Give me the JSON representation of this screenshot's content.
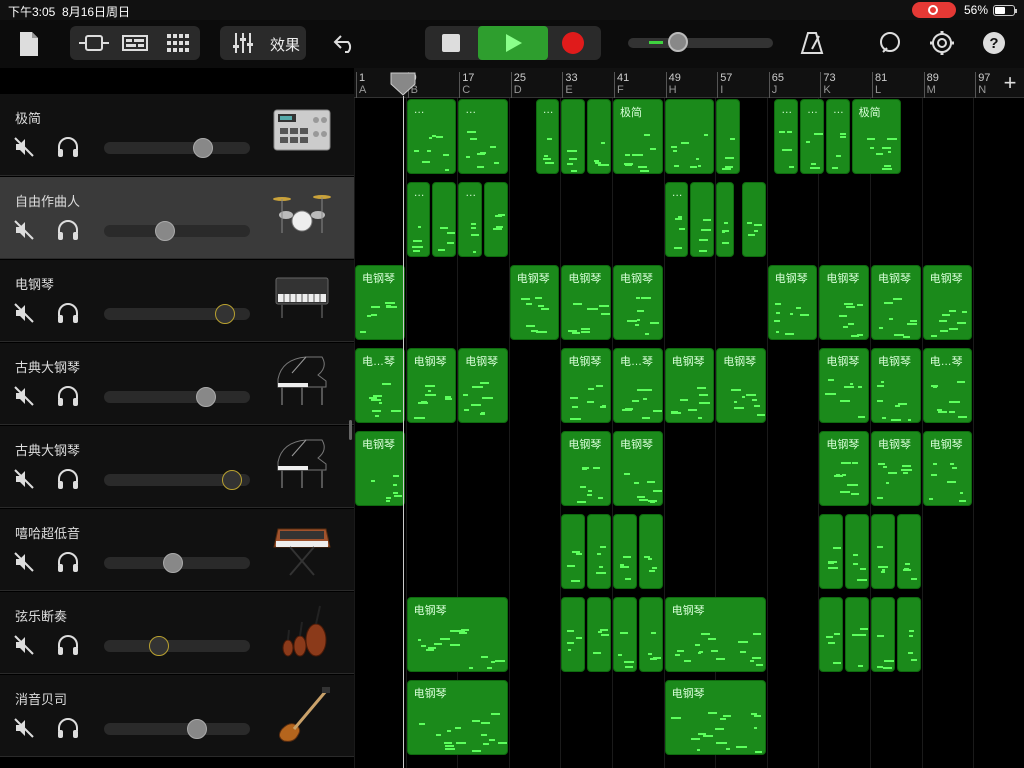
{
  "status_bar": {
    "time": "下午3:05",
    "date": "8月16日周日",
    "battery_pct": "56%"
  },
  "toolbar": {
    "fx_label": "效果",
    "accent": "#2e9e2e",
    "record_color": "#e01b1b"
  },
  "ruler": {
    "bars": [
      {
        "num": "1",
        "letter": "A"
      },
      {
        "num": "9",
        "letter": "B"
      },
      {
        "num": "17",
        "letter": "C"
      },
      {
        "num": "25",
        "letter": "D"
      },
      {
        "num": "33",
        "letter": "E"
      },
      {
        "num": "41",
        "letter": "F"
      },
      {
        "num": "49",
        "letter": "H"
      },
      {
        "num": "57",
        "letter": "I"
      },
      {
        "num": "65",
        "letter": "J"
      },
      {
        "num": "73",
        "letter": "K"
      },
      {
        "num": "81",
        "letter": "L"
      },
      {
        "num": "89",
        "letter": "M"
      },
      {
        "num": "97",
        "letter": "N"
      }
    ],
    "add_label": "+"
  },
  "tracks": [
    {
      "name": "极简",
      "instrument": "drum-machine-icon",
      "volume": 0.68,
      "gold": false,
      "selected": false
    },
    {
      "name": "自由作曲人",
      "instrument": "drum-kit-icon",
      "volume": 0.42,
      "gold": false,
      "selected": true
    },
    {
      "name": "电钢琴",
      "instrument": "electric-piano-icon",
      "volume": 0.83,
      "gold": true,
      "selected": false
    },
    {
      "name": "古典大钢琴",
      "instrument": "grand-piano-icon",
      "volume": 0.7,
      "gold": false,
      "selected": false
    },
    {
      "name": "古典大钢琴",
      "instrument": "grand-piano-icon",
      "volume": 0.88,
      "gold": true,
      "selected": false
    },
    {
      "name": "嘻哈超低音",
      "instrument": "synth-keyboard-icon",
      "volume": 0.47,
      "gold": false,
      "selected": false
    },
    {
      "name": "弦乐断奏",
      "instrument": "strings-icon",
      "volume": 0.38,
      "gold": true,
      "selected": false
    },
    {
      "name": "消音贝司",
      "instrument": "bass-guitar-icon",
      "volume": 0.64,
      "gold": false,
      "selected": false
    }
  ],
  "regions": [
    {
      "track": 0,
      "bars": [
        [
          9,
          17,
          "…"
        ],
        [
          17,
          25,
          "…"
        ],
        [
          29,
          33,
          "…"
        ],
        [
          33,
          37,
          ""
        ],
        [
          37,
          41,
          ""
        ],
        [
          41,
          49,
          "极简"
        ],
        [
          49,
          57,
          ""
        ],
        [
          57,
          61,
          ""
        ],
        [
          66,
          70,
          "…"
        ],
        [
          70,
          74,
          "…"
        ],
        [
          74,
          78,
          "…"
        ],
        [
          78,
          86,
          "极简"
        ]
      ]
    },
    {
      "track": 1,
      "bars": [
        [
          9,
          13,
          "…"
        ],
        [
          13,
          17,
          ""
        ],
        [
          17,
          21,
          "…"
        ],
        [
          21,
          25,
          ""
        ],
        [
          49,
          53,
          "…"
        ],
        [
          53,
          57,
          ""
        ],
        [
          57,
          60,
          ""
        ],
        [
          61,
          65,
          ""
        ]
      ]
    },
    {
      "track": 2,
      "bars": [
        [
          1,
          9,
          "电钢琴"
        ],
        [
          25,
          33,
          "电钢琴"
        ],
        [
          33,
          41,
          "电钢琴"
        ],
        [
          41,
          49,
          "电钢琴"
        ],
        [
          65,
          73,
          "电钢琴"
        ],
        [
          73,
          81,
          "电钢琴"
        ],
        [
          81,
          89,
          "电钢琴"
        ],
        [
          89,
          97,
          "电钢琴"
        ]
      ]
    },
    {
      "track": 3,
      "bars": [
        [
          1,
          9,
          "电…琴"
        ],
        [
          9,
          17,
          "电钢琴"
        ],
        [
          17,
          25,
          "电钢琴"
        ],
        [
          33,
          41,
          "电钢琴"
        ],
        [
          41,
          49,
          "电…琴"
        ],
        [
          49,
          57,
          "电钢琴"
        ],
        [
          57,
          65,
          "电钢琴"
        ],
        [
          73,
          81,
          "电钢琴"
        ],
        [
          81,
          89,
          "电钢琴"
        ],
        [
          89,
          97,
          "电…琴"
        ]
      ]
    },
    {
      "track": 4,
      "bars": [
        [
          1,
          9,
          "电钢琴"
        ],
        [
          33,
          41,
          "电钢琴"
        ],
        [
          41,
          49,
          "电钢琴"
        ],
        [
          73,
          81,
          "电钢琴"
        ],
        [
          81,
          89,
          "电钢琴"
        ],
        [
          89,
          97,
          "电钢琴"
        ]
      ]
    },
    {
      "track": 5,
      "bars": [
        [
          33,
          37,
          ""
        ],
        [
          37,
          41,
          ""
        ],
        [
          41,
          45,
          ""
        ],
        [
          45,
          49,
          ""
        ],
        [
          73,
          77,
          ""
        ],
        [
          77,
          81,
          ""
        ],
        [
          81,
          85,
          ""
        ],
        [
          85,
          89,
          ""
        ]
      ]
    },
    {
      "track": 6,
      "bars": [
        [
          9,
          25,
          "电钢琴"
        ],
        [
          33,
          37,
          ""
        ],
        [
          37,
          41,
          ""
        ],
        [
          41,
          45,
          ""
        ],
        [
          45,
          49,
          ""
        ],
        [
          49,
          65,
          "电钢琴"
        ],
        [
          73,
          77,
          ""
        ],
        [
          77,
          81,
          ""
        ],
        [
          81,
          85,
          ""
        ],
        [
          85,
          89,
          ""
        ]
      ]
    },
    {
      "track": 7,
      "bars": [
        [
          9,
          25,
          "电钢琴"
        ],
        [
          49,
          65,
          "电钢琴"
        ]
      ]
    }
  ]
}
